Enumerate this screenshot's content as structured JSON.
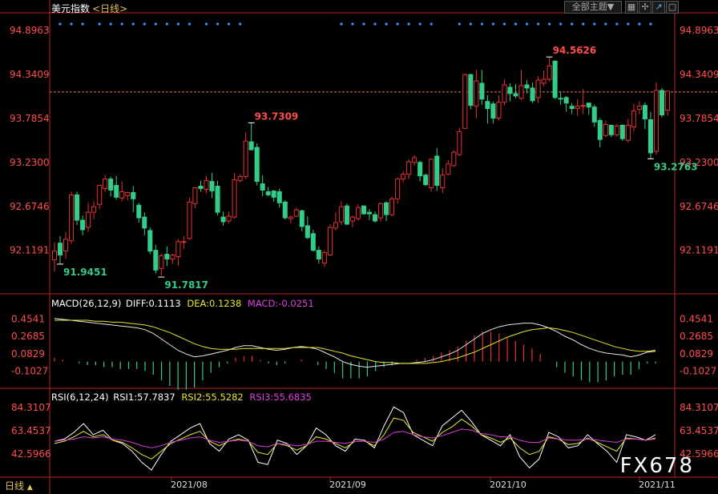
{
  "header": {
    "title": "美元指数",
    "period_tag": "<日线>",
    "theme_button": "全部主题▼",
    "period_footer": "日线",
    "watermark": "FX678"
  },
  "chart_data": [
    {
      "type": "candlestick",
      "title": "美元指数 <日线>",
      "y_ticks": [
        94.8963,
        94.3409,
        93.7854,
        93.23,
        92.6746,
        92.1191
      ],
      "ylim": [
        91.6,
        95.1
      ],
      "reference_line": 94.12,
      "x_ticks": [
        "2021/08",
        "2021/09",
        "2021/10",
        "2021/11"
      ],
      "annotations": [
        {
          "label": "94.5626",
          "value": 94.5626,
          "kind": "high"
        },
        {
          "label": "93.7309",
          "value": 93.7309,
          "kind": "high"
        },
        {
          "label": "93.2763",
          "value": 93.2763,
          "kind": "low"
        },
        {
          "label": "91.7817",
          "value": 91.7817,
          "kind": "low"
        },
        {
          "label": "91.9451",
          "value": 91.9451,
          "kind": "low"
        }
      ],
      "candles": [
        [
          92.0,
          92.11,
          91.85,
          92.22
        ],
        [
          92.21,
          92.06,
          91.95,
          92.3
        ],
        [
          92.11,
          92.26,
          92.01,
          92.35
        ],
        [
          92.24,
          92.82,
          92.2,
          92.86
        ],
        [
          92.82,
          92.5,
          92.44,
          92.86
        ],
        [
          92.5,
          92.38,
          92.31,
          92.56
        ],
        [
          92.41,
          92.6,
          92.35,
          92.72
        ],
        [
          92.6,
          92.67,
          92.51,
          92.74
        ],
        [
          92.7,
          92.94,
          92.64,
          92.95
        ],
        [
          92.9,
          93.02,
          92.86,
          93.07
        ],
        [
          93.02,
          92.88,
          92.8,
          93.05
        ],
        [
          92.94,
          92.79,
          92.76,
          93.06
        ],
        [
          92.78,
          92.86,
          92.74,
          92.99
        ],
        [
          92.81,
          92.85,
          92.75,
          92.86
        ],
        [
          92.85,
          92.77,
          92.6,
          92.93
        ],
        [
          92.69,
          92.53,
          92.47,
          92.72
        ],
        [
          92.54,
          92.4,
          92.31,
          92.6
        ],
        [
          92.37,
          92.11,
          92.07,
          92.41
        ],
        [
          92.12,
          91.87,
          91.83,
          92.19
        ],
        [
          91.89,
          92.05,
          91.8,
          92.08
        ],
        [
          92.07,
          92.01,
          91.92,
          92.17
        ],
        [
          92.01,
          92.06,
          91.95,
          92.08
        ],
        [
          92.04,
          92.23,
          91.92,
          92.26
        ],
        [
          92.23,
          92.23,
          92.14,
          92.3
        ],
        [
          92.27,
          92.73,
          92.25,
          92.79
        ],
        [
          92.71,
          92.91,
          92.65,
          92.91
        ],
        [
          92.93,
          92.9,
          92.86,
          93.0
        ],
        [
          92.89,
          93.0,
          92.84,
          93.06
        ],
        [
          92.99,
          92.87,
          92.78,
          93.1
        ],
        [
          92.93,
          92.6,
          92.56,
          93.0
        ],
        [
          92.54,
          92.48,
          92.43,
          92.61
        ],
        [
          92.49,
          92.55,
          92.46,
          92.61
        ],
        [
          92.54,
          93.01,
          92.52,
          93.1
        ],
        [
          93.0,
          93.05,
          92.98,
          93.08
        ],
        [
          93.05,
          93.5,
          93.02,
          93.61
        ],
        [
          93.49,
          93.39,
          93.38,
          93.73
        ],
        [
          93.42,
          92.99,
          92.94,
          93.47
        ],
        [
          92.96,
          92.88,
          92.8,
          93.07
        ],
        [
          92.86,
          92.82,
          92.8,
          92.92
        ],
        [
          92.87,
          92.79,
          92.73,
          92.88
        ],
        [
          92.86,
          92.72,
          92.66,
          92.9
        ],
        [
          92.73,
          92.53,
          92.51,
          92.75
        ],
        [
          92.52,
          92.54,
          92.46,
          92.56
        ],
        [
          92.55,
          92.63,
          92.54,
          92.66
        ],
        [
          92.62,
          92.42,
          92.36,
          92.63
        ],
        [
          92.43,
          92.28,
          92.26,
          92.55
        ],
        [
          92.33,
          92.12,
          92.1,
          92.38
        ],
        [
          92.12,
          92.01,
          91.95,
          92.17
        ],
        [
          91.96,
          92.09,
          91.91,
          92.12
        ],
        [
          92.06,
          92.41,
          92.05,
          92.45
        ],
        [
          92.4,
          92.47,
          92.37,
          92.6
        ],
        [
          92.48,
          92.67,
          92.44,
          92.74
        ],
        [
          92.68,
          92.45,
          92.44,
          92.71
        ],
        [
          92.49,
          92.54,
          92.41,
          92.56
        ],
        [
          92.52,
          92.66,
          92.49,
          92.7
        ],
        [
          92.68,
          92.58,
          92.57,
          92.68
        ],
        [
          92.6,
          92.58,
          92.5,
          92.64
        ],
        [
          92.57,
          92.49,
          92.47,
          92.61
        ],
        [
          92.53,
          92.71,
          92.48,
          92.72
        ],
        [
          92.72,
          92.57,
          92.49,
          92.74
        ],
        [
          92.57,
          92.77,
          92.55,
          92.8
        ],
        [
          92.77,
          93.02,
          92.71,
          93.04
        ],
        [
          93.02,
          93.08,
          92.98,
          93.12
        ],
        [
          93.08,
          93.24,
          93.02,
          93.27
        ],
        [
          93.23,
          93.29,
          93.19,
          93.32
        ],
        [
          93.23,
          93.06,
          92.99,
          93.25
        ],
        [
          93.07,
          92.95,
          92.93,
          93.09
        ],
        [
          92.91,
          93.27,
          92.86,
          93.28
        ],
        [
          93.31,
          92.94,
          92.87,
          93.41
        ],
        [
          92.91,
          93.07,
          92.84,
          93.16
        ],
        [
          93.08,
          93.21,
          93.07,
          93.26
        ],
        [
          93.19,
          93.36,
          93.17,
          93.38
        ],
        [
          93.33,
          93.62,
          93.31,
          93.67
        ],
        [
          93.66,
          94.34,
          93.66,
          94.35
        ],
        [
          94.34,
          93.95,
          93.9,
          94.35
        ],
        [
          93.94,
          94.26,
          93.79,
          94.4
        ],
        [
          94.23,
          94.03,
          93.96,
          94.4
        ],
        [
          94.0,
          93.91,
          93.72,
          94.08
        ],
        [
          93.97,
          93.79,
          93.72,
          94.0
        ],
        [
          93.79,
          93.99,
          93.76,
          94.08
        ],
        [
          93.99,
          94.21,
          93.95,
          94.28
        ],
        [
          94.18,
          94.1,
          94.0,
          94.23
        ],
        [
          94.1,
          94.07,
          94.04,
          94.22
        ],
        [
          94.04,
          94.2,
          94.02,
          94.4
        ],
        [
          94.21,
          94.17,
          94.1,
          94.27
        ],
        [
          94.17,
          94.01,
          93.98,
          94.24
        ],
        [
          94.05,
          94.27,
          93.98,
          94.32
        ],
        [
          94.23,
          94.28,
          94.19,
          94.39
        ],
        [
          94.28,
          94.45,
          94.25,
          94.56
        ],
        [
          94.51,
          94.05,
          94.03,
          94.52
        ],
        [
          94.04,
          94.03,
          93.96,
          94.13
        ],
        [
          94.05,
          93.98,
          93.87,
          94.07
        ],
        [
          93.94,
          93.91,
          93.84,
          93.98
        ],
        [
          93.91,
          93.94,
          93.82,
          94.03
        ],
        [
          93.94,
          93.95,
          93.84,
          94.16
        ],
        [
          93.98,
          93.93,
          93.83,
          93.98
        ],
        [
          93.93,
          93.74,
          93.68,
          93.96
        ],
        [
          93.76,
          93.52,
          93.42,
          93.79
        ],
        [
          93.57,
          93.71,
          93.55,
          93.76
        ],
        [
          93.7,
          93.58,
          93.55,
          93.7
        ],
        [
          93.58,
          93.69,
          93.56,
          93.72
        ],
        [
          93.7,
          93.53,
          93.5,
          93.71
        ],
        [
          93.51,
          93.7,
          93.48,
          93.78
        ],
        [
          93.68,
          93.88,
          93.62,
          93.97
        ],
        [
          93.9,
          93.94,
          93.84,
          94.0
        ],
        [
          93.95,
          93.78,
          93.65,
          93.99
        ],
        [
          93.77,
          93.35,
          93.28,
          93.87
        ],
        [
          93.37,
          94.14,
          93.33,
          94.24
        ],
        [
          94.14,
          93.83,
          93.8,
          94.17
        ],
        [
          93.89,
          94.13,
          93.82,
          94.13
        ]
      ],
      "dots_columns": [
        1,
        3,
        5,
        8,
        10,
        12,
        14,
        16,
        18,
        20,
        22,
        24,
        27,
        29,
        31,
        33,
        51,
        53,
        55,
        57,
        59,
        61,
        63,
        65,
        67,
        72,
        74,
        76,
        78,
        80,
        82,
        84,
        86,
        88,
        90,
        92,
        94,
        96,
        98,
        100,
        102,
        104,
        106
      ]
    },
    {
      "type": "line",
      "title": "MACD(26,12,9)",
      "legend": [
        "DIFF:0.1113",
        "DEA:0.1238",
        "MACD:-0.0251"
      ],
      "y_ticks": [
        0.4541,
        0.2685,
        0.0829,
        -0.1027
      ],
      "ylim": [
        -0.26,
        0.56
      ],
      "series": [
        {
          "name": "DIFF",
          "color": "#e8e8e8",
          "values": [
            0.46,
            0.45,
            0.44,
            0.43,
            0.42,
            0.41,
            0.4,
            0.39,
            0.38,
            0.37,
            0.36,
            0.34,
            0.3,
            0.24,
            0.18,
            0.12,
            0.08,
            0.05,
            0.06,
            0.08,
            0.1,
            0.12,
            0.15,
            0.17,
            0.17,
            0.15,
            0.13,
            0.12,
            0.13,
            0.15,
            0.16,
            0.15,
            0.13,
            0.09,
            0.05,
            0.0,
            -0.03,
            -0.05,
            -0.06,
            -0.05,
            -0.04,
            -0.03,
            -0.02,
            -0.02,
            -0.01,
            0.0,
            0.02,
            0.05,
            0.08,
            0.12,
            0.18,
            0.24,
            0.3,
            0.34,
            0.37,
            0.39,
            0.4,
            0.41,
            0.41,
            0.39,
            0.36,
            0.32,
            0.27,
            0.23,
            0.18,
            0.14,
            0.11,
            0.09,
            0.08,
            0.07,
            0.05,
            0.07,
            0.1,
            0.11
          ]
        },
        {
          "name": "DEA",
          "color": "#e6e62a",
          "values": [
            0.44,
            0.44,
            0.44,
            0.44,
            0.44,
            0.43,
            0.43,
            0.42,
            0.42,
            0.41,
            0.4,
            0.39,
            0.37,
            0.34,
            0.31,
            0.27,
            0.23,
            0.19,
            0.16,
            0.14,
            0.13,
            0.13,
            0.13,
            0.14,
            0.14,
            0.14,
            0.14,
            0.14,
            0.14,
            0.15,
            0.15,
            0.15,
            0.15,
            0.13,
            0.11,
            0.09,
            0.06,
            0.04,
            0.02,
            0.0,
            -0.01,
            -0.01,
            -0.02,
            -0.02,
            -0.02,
            -0.02,
            -0.01,
            0.0,
            0.02,
            0.04,
            0.07,
            0.1,
            0.14,
            0.18,
            0.22,
            0.26,
            0.29,
            0.32,
            0.34,
            0.35,
            0.36,
            0.35,
            0.33,
            0.31,
            0.28,
            0.25,
            0.22,
            0.19,
            0.16,
            0.14,
            0.12,
            0.11,
            0.11,
            0.12
          ]
        }
      ]
    },
    {
      "type": "line",
      "title": "RSI(6,12,24)",
      "legend": [
        "RSI1:57.7837",
        "RSI2:55.5282",
        "RSI3:55.6835"
      ],
      "y_ticks": [
        84.3107,
        63.4537,
        42.5966
      ],
      "ylim": [
        23,
        91
      ],
      "series": [
        {
          "name": "RSI1",
          "color": "#ffffff",
          "values": [
            54,
            56,
            62,
            70,
            60,
            64,
            55,
            52,
            45,
            35,
            28,
            42,
            54,
            60,
            66,
            70,
            52,
            45,
            56,
            60,
            55,
            35,
            33,
            55,
            52,
            42,
            50,
            66,
            60,
            50,
            45,
            56,
            55,
            48,
            68,
            85,
            80,
            60,
            55,
            50,
            68,
            75,
            82,
            72,
            60,
            55,
            50,
            60,
            40,
            30,
            38,
            62,
            58,
            48,
            50,
            60,
            52,
            45,
            35,
            60,
            58,
            55,
            60
          ]
        },
        {
          "name": "RSI2",
          "color": "#e6e62a",
          "values": [
            52,
            54,
            58,
            63,
            58,
            60,
            55,
            53,
            48,
            42,
            38,
            45,
            52,
            56,
            60,
            63,
            54,
            50,
            54,
            56,
            54,
            44,
            42,
            52,
            50,
            46,
            50,
            58,
            56,
            52,
            48,
            54,
            54,
            50,
            60,
            75,
            73,
            62,
            58,
            54,
            62,
            67,
            74,
            68,
            60,
            57,
            53,
            57,
            48,
            42,
            45,
            58,
            56,
            51,
            52,
            57,
            53,
            49,
            45,
            57,
            56,
            55,
            57
          ]
        },
        {
          "name": "RSI3",
          "color": "#d63cd6",
          "values": [
            54,
            55,
            56,
            58,
            57,
            58,
            56,
            55,
            53,
            50,
            48,
            50,
            53,
            55,
            57,
            58,
            55,
            53,
            54,
            55,
            54,
            50,
            49,
            52,
            51,
            50,
            51,
            54,
            54,
            53,
            52,
            54,
            54,
            53,
            56,
            62,
            63,
            60,
            58,
            57,
            59,
            62,
            65,
            64,
            61,
            60,
            58,
            58,
            55,
            53,
            53,
            57,
            56,
            55,
            55,
            56,
            55,
            54,
            53,
            56,
            56,
            55,
            56
          ]
        }
      ]
    }
  ]
}
